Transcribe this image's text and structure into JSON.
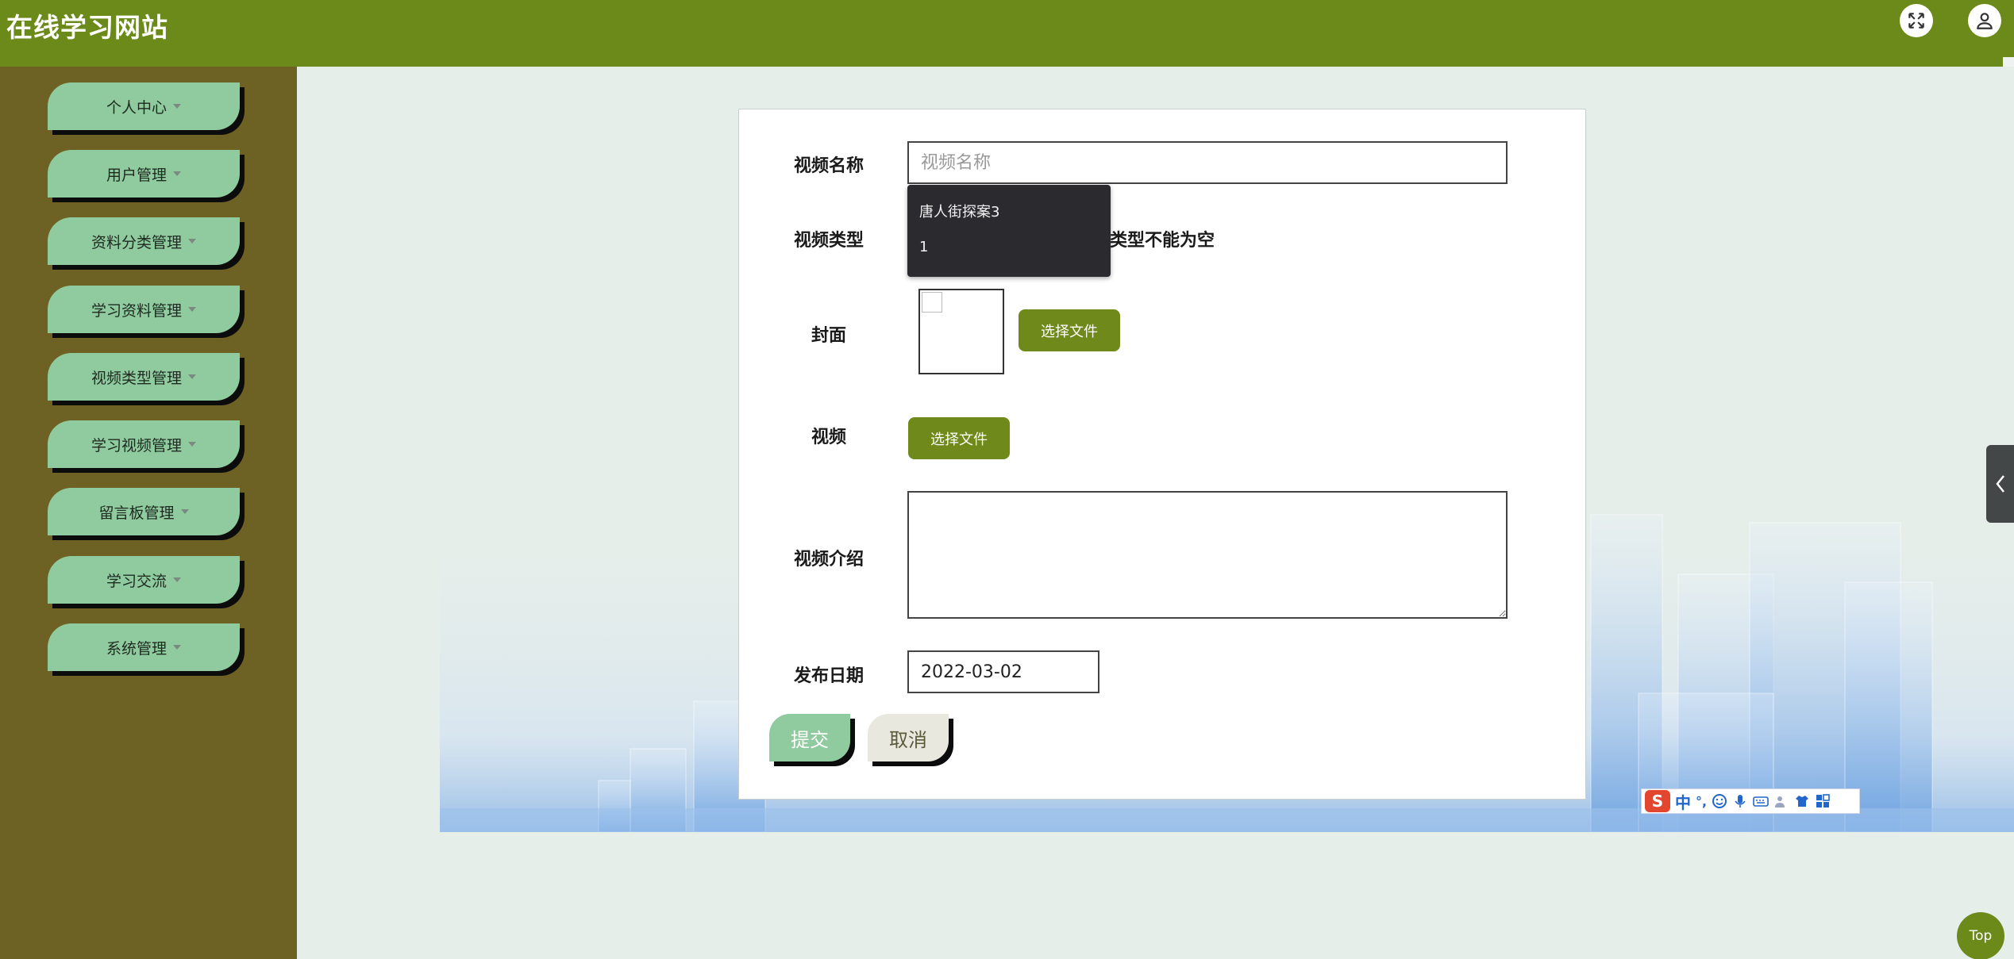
{
  "header": {
    "title": "在线学习网站",
    "fullscreen_icon": "expand-icon",
    "user_icon": "user-icon"
  },
  "sidebar": {
    "items": [
      {
        "label": "个人中心"
      },
      {
        "label": "用户管理"
      },
      {
        "label": "资料分类管理"
      },
      {
        "label": "学习资料管理"
      },
      {
        "label": "视频类型管理"
      },
      {
        "label": "学习视频管理"
      },
      {
        "label": "留言板管理"
      },
      {
        "label": "学习交流"
      },
      {
        "label": "系统管理"
      }
    ]
  },
  "form": {
    "name_label": "视频名称",
    "name_placeholder": "视频名称",
    "name_value": "",
    "type_label": "视频类型",
    "type_error": "类型不能为空",
    "type_options": [
      "唐人街探案3",
      "1"
    ],
    "cover_label": "封面",
    "cover_button": "选择文件",
    "video_label": "视频",
    "video_button": "选择文件",
    "intro_label": "视频介绍",
    "intro_value": "",
    "date_label": "发布日期",
    "date_value": "2022-03-02",
    "submit_label": "提交",
    "cancel_label": "取消"
  },
  "ime": {
    "logo": "S",
    "mode": "中",
    "punct": "°,"
  },
  "top_button": "Top",
  "colors": {
    "header": "#6b8a19",
    "sidebar": "#6e6124",
    "menu_item": "#8fcb9e",
    "olive_button": "#6f8a1a",
    "dropdown": "#2b2b2f"
  }
}
